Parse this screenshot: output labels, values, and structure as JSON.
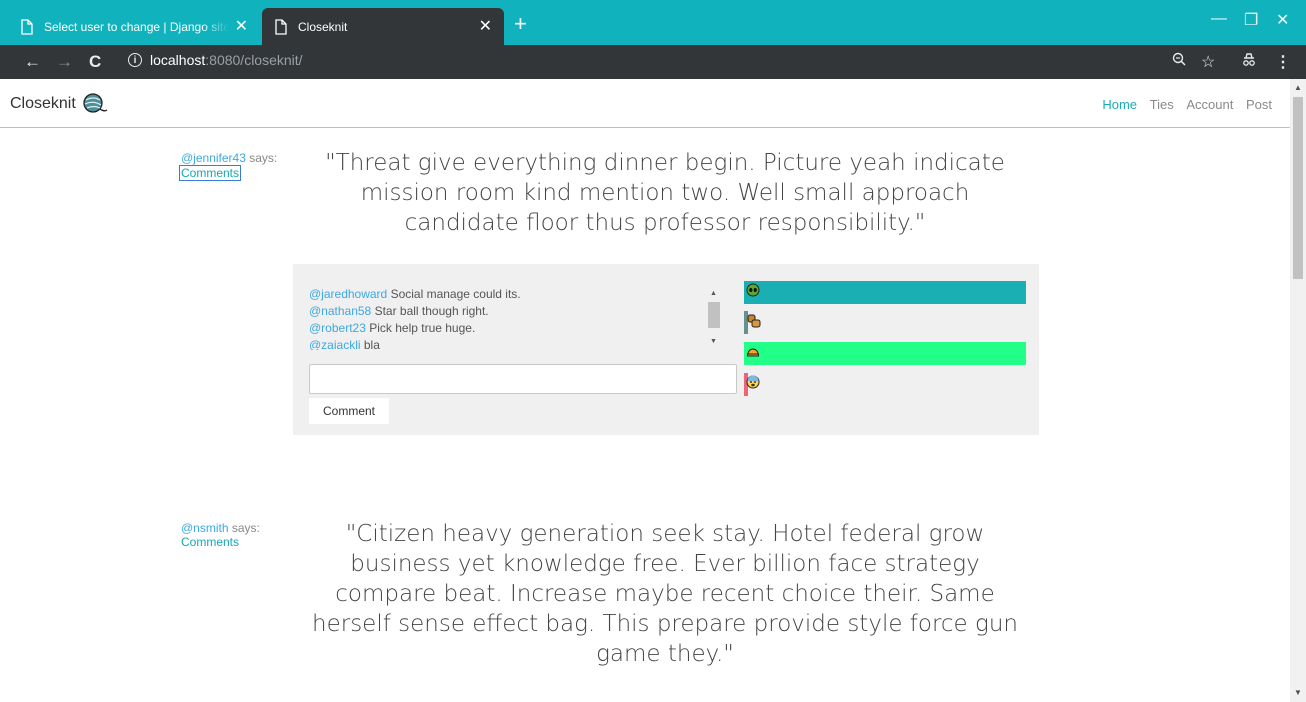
{
  "browser": {
    "tabs": [
      {
        "title": "Select user to change | Django site admin",
        "active": false
      },
      {
        "title": "Closeknit",
        "active": true
      }
    ],
    "url_host": "localhost",
    "url_rest": ":8080/closeknit/"
  },
  "navbar": {
    "brand": "Closeknit",
    "links": [
      {
        "label": "Home",
        "active": true
      },
      {
        "label": "Ties",
        "active": false
      },
      {
        "label": "Account",
        "active": false
      },
      {
        "label": "Post",
        "active": false
      }
    ]
  },
  "posts": [
    {
      "user": "@jennifer43",
      "says": " says:",
      "comments_label": "Comments",
      "quote_lines": [
        "\"Threat give everything dinner begin. Picture yeah indicate",
        "mission room kind mention two. Well small approach",
        "candidate floor thus professor responsibility.\""
      ],
      "comments": [
        {
          "user": "@jaredhoward",
          "text": " Social manage could its."
        },
        {
          "user": "@nathan58",
          "text": " Star ball though right."
        },
        {
          "user": "@robert23",
          "text": " Pick help true huge."
        },
        {
          "user": "@zaiackli",
          "text": " bla"
        }
      ],
      "comment_input_value": "",
      "comment_button": "Comment",
      "reactions": [
        {
          "icon": "alien-face-icon",
          "color": "#1aafb2",
          "fill": 1.0
        },
        {
          "icon": "fist-icon",
          "color": "#6b8f8f",
          "fill": 0.0
        },
        {
          "icon": "helmet-icon",
          "color": "#21ff88",
          "fill": 1.0
        },
        {
          "icon": "fearful-face-icon",
          "color": "#f0647a",
          "fill": 0.0
        }
      ]
    },
    {
      "user": "@nsmith",
      "says": " says:",
      "comments_label": "Comments",
      "quote_lines": [
        "\"Citizen heavy generation seek stay. Hotel federal grow",
        "business yet knowledge free. Ever billion face strategy",
        "compare beat. Increase maybe recent choice their. Same",
        "herself sense effect bag. This prepare provide style force gun",
        "game they.\""
      ]
    }
  ]
}
